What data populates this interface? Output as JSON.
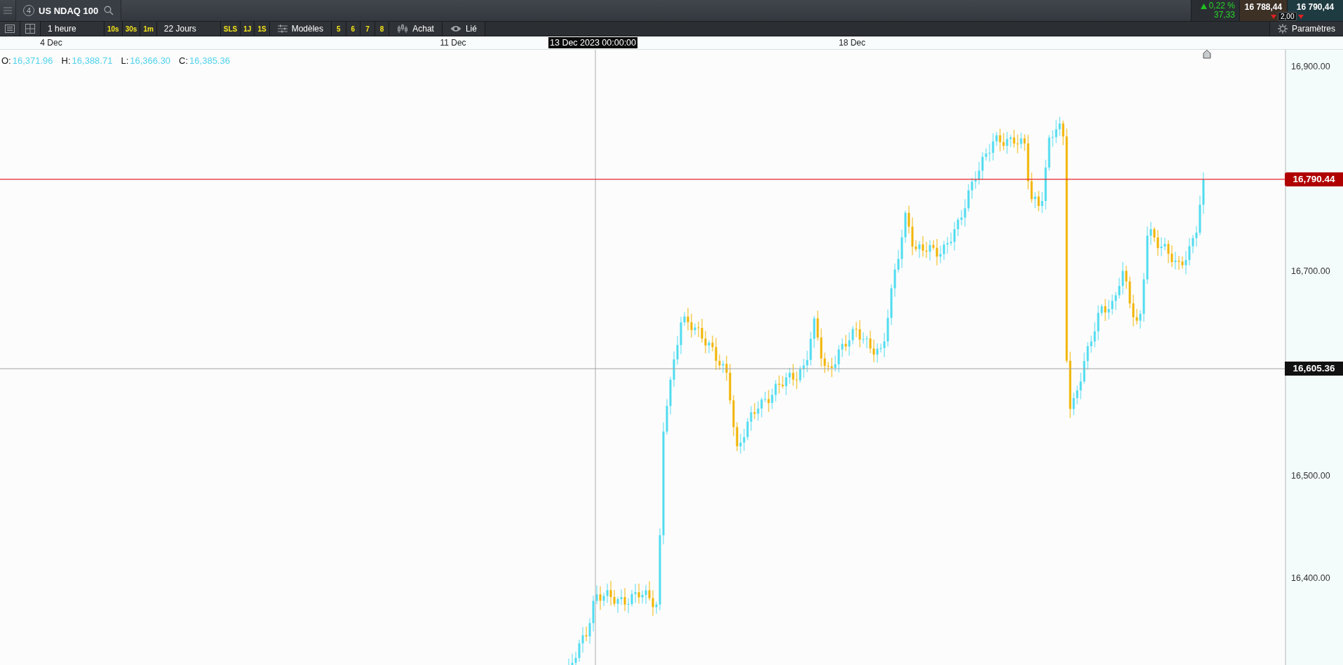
{
  "top_bar": {
    "tab": {
      "badge": "4",
      "title": "US NDAQ 100"
    },
    "change": {
      "rising": true,
      "percent": "0,22 %",
      "points": "37,33"
    },
    "bid": {
      "price": "16 788,44"
    },
    "ask": {
      "price": "16 790,44"
    },
    "spread": "2,00"
  },
  "toolbar": {
    "interval": "1 heure",
    "quick_intervals": [
      "10s",
      "30s",
      "1m"
    ],
    "range": "22 Jours",
    "shortcuts": [
      "SLS",
      "1J",
      "1S"
    ],
    "templates": "Modèles",
    "numbered": [
      "5",
      "6",
      "7",
      "8"
    ],
    "trade": "Achat",
    "link": "Lié",
    "settings": "Paramètres"
  },
  "chart": {
    "time_axis": [
      {
        "label": "4 Dec"
      },
      {
        "label": "11 Dec"
      },
      {
        "label": "18 Dec"
      }
    ],
    "crosshair_time": "13 Dec 2023 00:00:00",
    "ohlc": [
      {
        "key": "O:",
        "value": "16,371.96"
      },
      {
        "key": "H:",
        "value": "16,388.71"
      },
      {
        "key": "L:",
        "value": "16,366.30"
      },
      {
        "key": "C:",
        "value": "16,385.36"
      }
    ],
    "price_axis": [
      "16,900.00",
      "16,700.00",
      "16,500.00",
      "16,400.00"
    ],
    "last_price": "16,790.44",
    "crosshair_price": "16,605.36"
  }
}
